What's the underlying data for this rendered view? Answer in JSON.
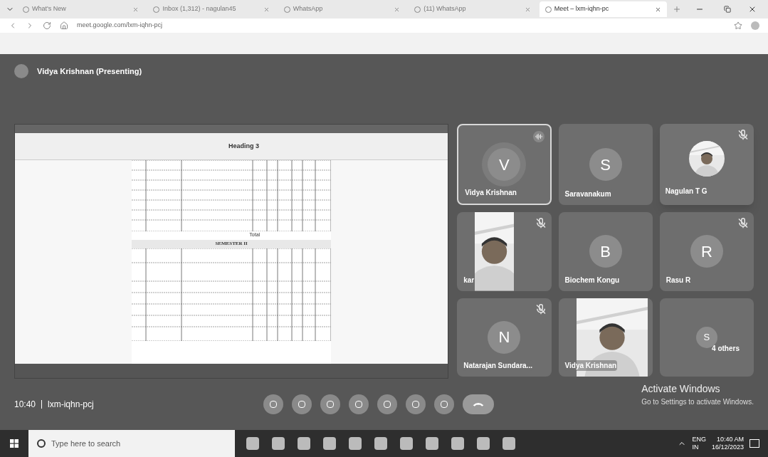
{
  "browser": {
    "tabs": [
      {
        "title": "What's New",
        "selected": false
      },
      {
        "title": "Inbox (1,312) - nagulan45",
        "selected": false
      },
      {
        "title": "WhatsApp",
        "selected": false
      },
      {
        "title": "(11) WhatsApp",
        "selected": false
      },
      {
        "title": "Meet – lxm-iqhn-pc",
        "selected": true
      }
    ],
    "url": "meet.google.com/lxm-iqhn-pcj"
  },
  "presenter_bar": {
    "title": "Vidya Krishnan (Presenting)"
  },
  "shared_screen": {
    "ribbon_style": "Heading 3",
    "section": "SEMESTER II",
    "total_label": "Total"
  },
  "tiles": [
    {
      "kind": "avatar",
      "initial": "V",
      "name": "Vidya Krishnan",
      "muted": false,
      "speaking": true
    },
    {
      "kind": "avatar",
      "initial": "S",
      "name": "Saravanakum",
      "muted": false,
      "speaking": false
    },
    {
      "kind": "video",
      "name": "kar",
      "muted": true,
      "speaking": false
    },
    {
      "kind": "avatar",
      "initial": "B",
      "name": "Biochem Kongu",
      "muted": false,
      "speaking": false
    },
    {
      "kind": "avatar",
      "initial": "R",
      "name": "Rasu R",
      "muted": true,
      "speaking": false
    },
    {
      "kind": "avatar",
      "initial": "N",
      "name": "Natarajan Sundara...",
      "muted": true,
      "speaking": false
    },
    {
      "kind": "video",
      "name": "Vidya Krishnan",
      "muted": false,
      "speaking": false
    },
    {
      "kind": "others",
      "initial": "S",
      "name": "4 others",
      "muted": false,
      "speaking": false
    }
  ],
  "floating_tile": {
    "name": "Nagulan T G",
    "muted": true
  },
  "meeting_info": {
    "time": "10:40",
    "code": "lxm-iqhn-pcj"
  },
  "activation": {
    "title": "Activate Windows",
    "text": "Go to Settings to activate Windows."
  },
  "taskbar": {
    "search_placeholder": "Type here to search",
    "language": "ENG",
    "region": "IN",
    "time": "10:40 AM",
    "date": "16/12/2023"
  }
}
